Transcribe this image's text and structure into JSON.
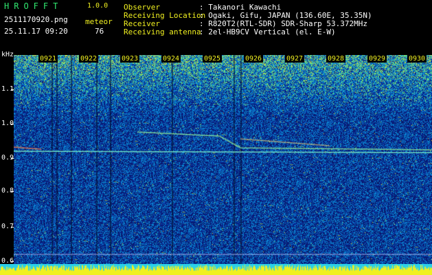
{
  "header": {
    "app_name": "HROFFT",
    "version": "1.0.0",
    "filename": "2511170920.png",
    "datetime": "25.11.17 09:20",
    "meteor_label": "meteor",
    "meteor_count": "76"
  },
  "info": {
    "observer_label": "Observer",
    "observer_value": ": Takanori Kawachi",
    "location_label": "Receiving Location",
    "location_value": ": Ogaki, Gifu, JAPAN (136.60E, 35.35N)",
    "receiver_label": "Receiver",
    "receiver_value": ": R820T2(RTL-SDR) SDR-Sharp 53.372MHz",
    "antenna_label": "Receiving antenna",
    "antenna_value": ": 2el-HB9CV Vertical (el. E-W)"
  },
  "axis": {
    "y_unit": "kHz",
    "y_ticks": [
      "1.1",
      "1.0",
      "0.9",
      "0.8",
      "0.7",
      "0.6"
    ],
    "x_ticks": [
      "0921",
      "0922",
      "0923",
      "0924",
      "0925",
      "0926",
      "0927",
      "0928",
      "0929",
      "0930"
    ]
  },
  "colors": {
    "label": "#f0f020",
    "value": "#ffffff",
    "accent": "#30e870",
    "background": "#000000",
    "spectrum_base": "#0a1a8a"
  }
}
